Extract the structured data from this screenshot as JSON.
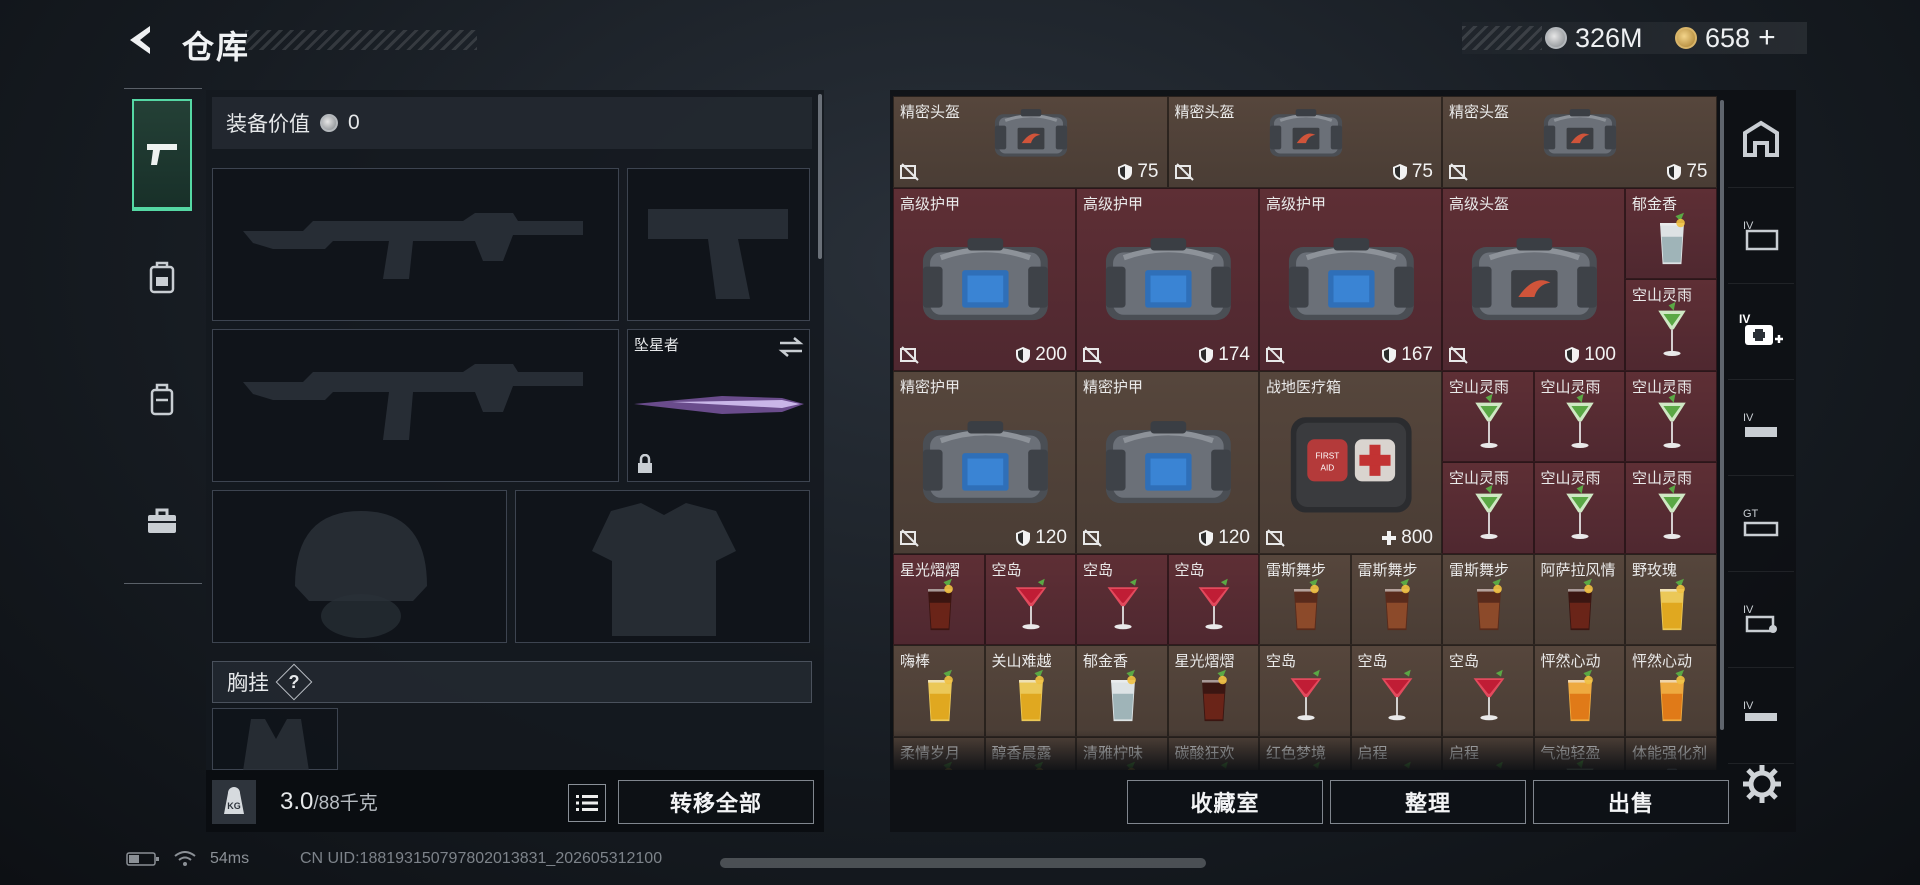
{
  "header": {
    "title": "仓库",
    "currency_silver": "326M",
    "currency_gold": "658",
    "currency_gold_plus": "+"
  },
  "left_tabs": [
    {
      "name": "weapons",
      "icon": "pistol-icon",
      "active": true
    },
    {
      "name": "gear",
      "icon": "backpack-gear-icon",
      "active": false
    },
    {
      "name": "backpack",
      "icon": "backpack-icon",
      "active": false
    },
    {
      "name": "toolbox",
      "icon": "toolbox-icon",
      "active": false
    }
  ],
  "equipment": {
    "value_label": "装备价值",
    "value": "0",
    "melee_name": "坠星者",
    "chest_label": "胸挂",
    "chest_help": "?"
  },
  "weight": {
    "current": "3.0",
    "max": "/88千克",
    "kg_label": "KG"
  },
  "buttons": {
    "transfer_all": "转移全部",
    "collection": "收藏室",
    "organize": "整理",
    "sell": "出售"
  },
  "storage_items": [
    {
      "label": "精密头盔",
      "value": "75",
      "type": "shield",
      "color": "brown",
      "art": "red-bag"
    },
    {
      "label": "精密头盔",
      "value": "75",
      "type": "shield",
      "color": "brown",
      "art": "red-bag"
    },
    {
      "label": "精密头盔",
      "value": "75",
      "type": "shield",
      "color": "brown",
      "art": "red-bag"
    },
    {
      "label": "高级护甲",
      "value": "200",
      "type": "shield",
      "color": "red",
      "art": "blue-bag"
    },
    {
      "label": "高级护甲",
      "value": "174",
      "type": "shield",
      "color": "red",
      "art": "blue-bag"
    },
    {
      "label": "高级护甲",
      "value": "167",
      "type": "shield",
      "color": "red",
      "art": "blue-bag"
    },
    {
      "label": "高级头盔",
      "value": "100",
      "type": "shield",
      "color": "red",
      "art": "red-bag"
    },
    {
      "label": "郁金香",
      "value": "",
      "type": "",
      "color": "red",
      "art": "drink-clear"
    },
    {
      "label": "空山灵雨",
      "value": "",
      "type": "",
      "color": "red",
      "art": "drink-green"
    },
    {
      "label": "精密护甲",
      "value": "120",
      "type": "shield",
      "color": "brown",
      "art": "blue-bag"
    },
    {
      "label": "精密护甲",
      "value": "120",
      "type": "shield",
      "color": "brown",
      "art": "blue-bag"
    },
    {
      "label": "战地医疗箱",
      "value": "800",
      "type": "heal",
      "color": "brown",
      "art": "medkit",
      "kit_text": "FIRST AID"
    },
    {
      "label": "空山灵雨",
      "value": "",
      "type": "",
      "color": "red",
      "art": "drink-green"
    },
    {
      "label": "空山灵雨",
      "value": "",
      "type": "",
      "color": "red",
      "art": "drink-green"
    },
    {
      "label": "空山灵雨",
      "value": "",
      "type": "",
      "color": "red",
      "art": "drink-green"
    },
    {
      "label": "空山灵雨",
      "value": "",
      "type": "",
      "color": "red",
      "art": "drink-green"
    },
    {
      "label": "空山灵雨",
      "value": "",
      "type": "",
      "color": "red",
      "art": "drink-green"
    },
    {
      "label": "空山灵雨",
      "value": "",
      "type": "",
      "color": "red",
      "art": "drink-green"
    },
    {
      "label": "星光熠熠",
      "value": "",
      "type": "",
      "color": "red",
      "art": "drink-cola"
    },
    {
      "label": "空岛",
      "value": "",
      "type": "",
      "color": "red",
      "art": "drink-red"
    },
    {
      "label": "空岛",
      "value": "",
      "type": "",
      "color": "red",
      "art": "drink-red"
    },
    {
      "label": "空岛",
      "value": "",
      "type": "",
      "color": "red",
      "art": "drink-red"
    },
    {
      "label": "雷斯舞步",
      "value": "",
      "type": "",
      "color": "brown",
      "art": "drink-tumbler"
    },
    {
      "label": "雷斯舞步",
      "value": "",
      "type": "",
      "color": "brown",
      "art": "drink-tumbler"
    },
    {
      "label": "雷斯舞步",
      "value": "",
      "type": "",
      "color": "brown",
      "art": "drink-tumbler"
    },
    {
      "label": "阿萨拉风情",
      "value": "",
      "type": "",
      "color": "brown",
      "art": "drink-cola"
    },
    {
      "label": "野玫瑰",
      "value": "",
      "type": "",
      "color": "brown",
      "art": "drink-yellow"
    },
    {
      "label": "嗨棒",
      "value": "",
      "type": "",
      "color": "brown",
      "art": "drink-yellow"
    },
    {
      "label": "关山难越",
      "value": "",
      "type": "",
      "color": "brown",
      "art": "drink-yellow"
    },
    {
      "label": "郁金香",
      "value": "",
      "type": "",
      "color": "brown",
      "art": "drink-clear"
    },
    {
      "label": "星光熠熠",
      "value": "",
      "type": "",
      "color": "brown",
      "art": "drink-cola"
    },
    {
      "label": "空岛",
      "value": "",
      "type": "",
      "color": "brown",
      "art": "drink-red"
    },
    {
      "label": "空岛",
      "value": "",
      "type": "",
      "color": "brown",
      "art": "drink-red"
    },
    {
      "label": "空岛",
      "value": "",
      "type": "",
      "color": "brown",
      "art": "drink-red"
    },
    {
      "label": "怦然心动",
      "value": "",
      "type": "",
      "color": "brown",
      "art": "drink-orange"
    },
    {
      "label": "怦然心动",
      "value": "",
      "type": "",
      "color": "brown",
      "art": "drink-orange"
    },
    {
      "label": "柔情岁月",
      "value": "",
      "type": "",
      "color": "brown",
      "art": "drink-clear"
    },
    {
      "label": "醇香晨露",
      "value": "",
      "type": "",
      "color": "brown",
      "art": "drink-yellow"
    },
    {
      "label": "清雅柠味",
      "value": "",
      "type": "",
      "color": "brown",
      "art": "drink-yellow"
    },
    {
      "label": "碳酸狂欢",
      "value": "",
      "type": "",
      "color": "brown",
      "art": "drink-red"
    },
    {
      "label": "红色梦境",
      "value": "",
      "type": "",
      "color": "brown",
      "art": "drink-red"
    },
    {
      "label": "启程",
      "value": "",
      "type": "",
      "color": "brown",
      "art": "drink-red"
    },
    {
      "label": "启程",
      "value": "",
      "type": "",
      "color": "brown",
      "art": "drink-red"
    },
    {
      "label": "气泡轻盈",
      "value": "",
      "type": "",
      "color": "brown",
      "art": "drink-green"
    },
    {
      "label": "体能强化剂",
      "value": "",
      "type": "",
      "color": "brown",
      "art": "syringe"
    }
  ],
  "category_icons": [
    "safe-room-icon",
    "folder-iv-icon",
    "medkit-iv-icon",
    "weapon-iv-icon",
    "gun-iv-icon",
    "gear-iv-icon",
    "helmet-iv-icon"
  ],
  "status": {
    "ping": "54ms",
    "uid": "CN UID:188193150797802013831_202605312100"
  },
  "colors": {
    "accent": "#55d8a4",
    "cell_brown": "#4f4038",
    "cell_red": "#55292f",
    "panel": "#14191f"
  }
}
